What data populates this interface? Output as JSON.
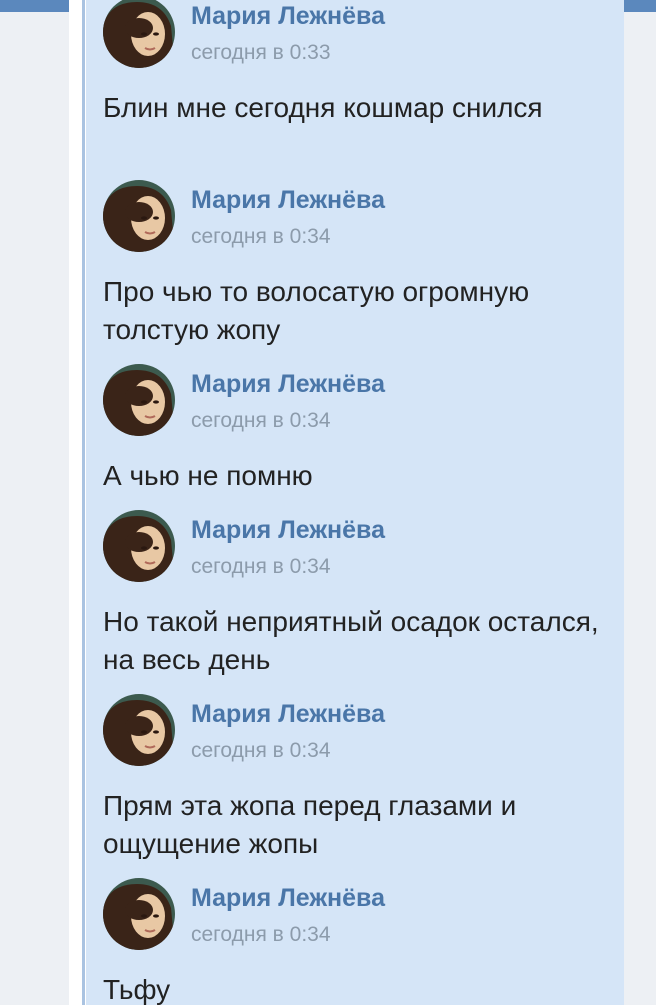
{
  "colors": {
    "top_bar": "#5b88bd",
    "page_bg": "#edf0f4",
    "thread_bg": "#d5e5f7",
    "author_link": "#4a76a8",
    "timestamp": "#8c9bab",
    "message_text": "#222222"
  },
  "messages": [
    {
      "author": "Мария Лежнёва",
      "time": "сегодня в 0:33",
      "text": "Блин мне сегодня кошмар снился"
    },
    {
      "author": "Мария Лежнёва",
      "time": "сегодня в 0:34",
      "text": "Про чью то волосатую огромную толстую жопу"
    },
    {
      "author": "Мария Лежнёва",
      "time": "сегодня в 0:34",
      "text": "А чью не помню"
    },
    {
      "author": "Мария Лежнёва",
      "time": "сегодня в 0:34",
      "text": "Но такой неприятный осадок остался, на весь день"
    },
    {
      "author": "Мария Лежнёва",
      "time": "сегодня в 0:34",
      "text": "Прям эта жопа перед глазами и ощущение жопы"
    },
    {
      "author": "Мария Лежнёва",
      "time": "сегодня в 0:34",
      "text": "Тьфу"
    }
  ]
}
